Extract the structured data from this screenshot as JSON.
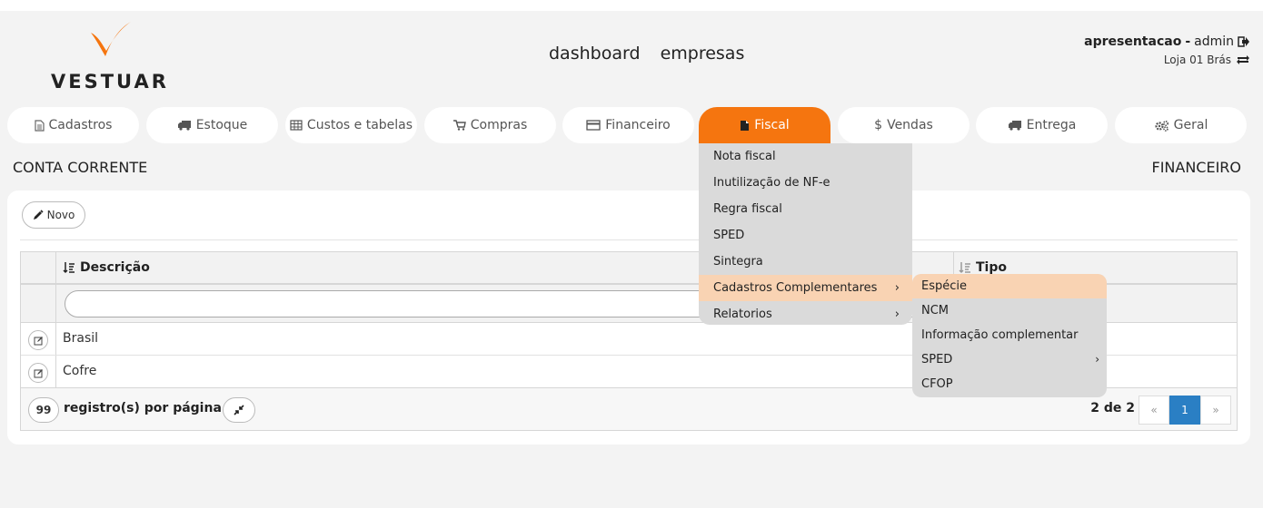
{
  "brand": {
    "logo_text": "VESTUAR",
    "accent_color": "#f5750f"
  },
  "topnav": {
    "items": [
      "dashboard",
      "empresas"
    ]
  },
  "user": {
    "company": "apresentacao",
    "separator": " - ",
    "name": "admin",
    "store": "Loja 01 Brás"
  },
  "tabs": [
    {
      "label": "Cadastros",
      "icon": "file-icon"
    },
    {
      "label": "Estoque",
      "icon": "truck-icon"
    },
    {
      "label": "Custos e tabelas",
      "icon": "table-icon"
    },
    {
      "label": "Compras",
      "icon": "cart-icon"
    },
    {
      "label": "Financeiro",
      "icon": "credit-card-icon"
    },
    {
      "label": "Fiscal",
      "icon": "file-icon",
      "active": true
    },
    {
      "label": "Vendas",
      "icon": "dollar-icon"
    },
    {
      "label": "Entrega",
      "icon": "truck-icon"
    },
    {
      "label": "Geral",
      "icon": "gears-icon"
    }
  ],
  "page": {
    "title": "CONTA CORRENTE",
    "module": "FINANCEIRO"
  },
  "toolbar": {
    "new_label": "Novo"
  },
  "table": {
    "columns": [
      "Descrição",
      "Tipo"
    ],
    "rows": [
      {
        "descricao": "Brasil"
      },
      {
        "descricao": "Cofre"
      }
    ],
    "per_page": "99",
    "per_page_label": "registro(s) por página",
    "page_info": "2 de 2",
    "pager": {
      "prev": "«",
      "current": "1",
      "next": "»"
    }
  },
  "fiscal_menu": {
    "items": [
      {
        "label": "Nota fiscal"
      },
      {
        "label": "Inutilização de NF-e"
      },
      {
        "label": "Regra fiscal"
      },
      {
        "label": "SPED"
      },
      {
        "label": "Sintegra"
      },
      {
        "label": "Cadastros Complementares",
        "arrow": "›"
      },
      {
        "label": "Relatorios",
        "arrow": "›"
      }
    ]
  },
  "sub_menu": {
    "items": [
      {
        "label": "Espécie"
      },
      {
        "label": "NCM"
      },
      {
        "label": "Informação complementar"
      },
      {
        "label": "SPED",
        "arrow": "›"
      },
      {
        "label": "CFOP"
      }
    ]
  }
}
